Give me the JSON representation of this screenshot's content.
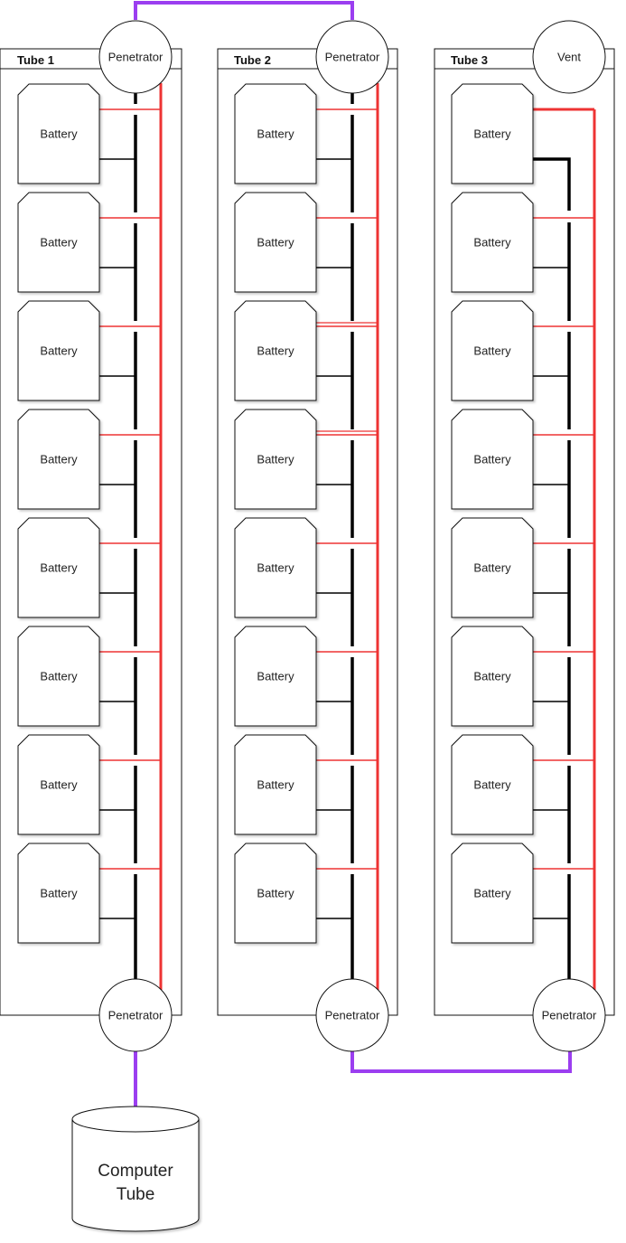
{
  "tubes": [
    {
      "title": "Tube 1",
      "top_node": "Penetrator",
      "bottom_node": "Penetrator",
      "batteries": [
        "Battery",
        "Battery",
        "Battery",
        "Battery",
        "Battery",
        "Battery",
        "Battery",
        "Battery"
      ]
    },
    {
      "title": "Tube 2",
      "top_node": "Penetrator",
      "bottom_node": "Penetrator",
      "batteries": [
        "Battery",
        "Battery",
        "Battery",
        "Battery",
        "Battery",
        "Battery",
        "Battery",
        "Battery"
      ]
    },
    {
      "title": "Tube 3",
      "top_node": "Vent",
      "bottom_node": "Penetrator",
      "batteries": [
        "Battery",
        "Battery",
        "Battery",
        "Battery",
        "Battery",
        "Battery",
        "Battery",
        "Battery"
      ]
    }
  ],
  "computer": {
    "line1": "Computer",
    "line2": "Tube"
  },
  "colors": {
    "negative_bus": "#000000",
    "positive_bus": "#ee3333",
    "interconnect": "#9b3ef0",
    "outline": "#111111"
  }
}
